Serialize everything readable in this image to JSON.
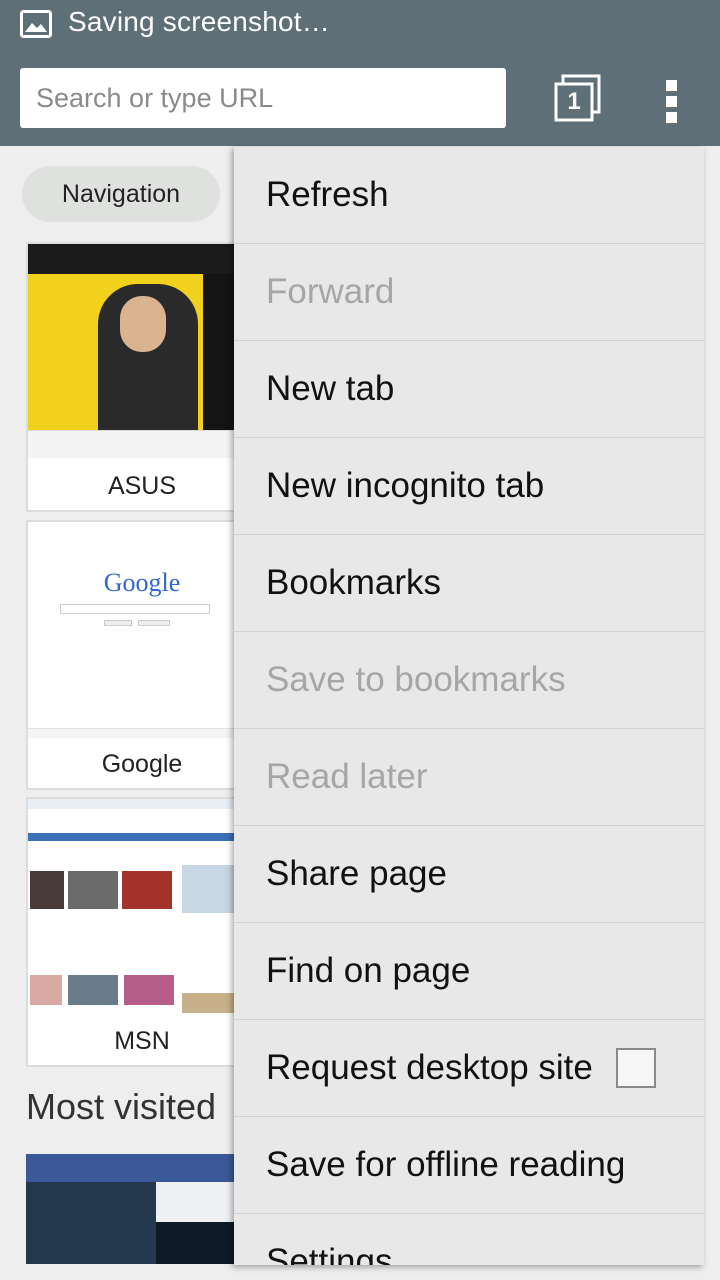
{
  "status_bar": {
    "text": "Saving screenshot…",
    "icon": "image-icon"
  },
  "toolbar": {
    "search_placeholder": "Search or type URL",
    "tab_count": "1",
    "tabs_icon": "tabs-icon",
    "menu_icon": "overflow-menu-icon"
  },
  "page": {
    "nav_chip": "Navigation",
    "tiles": [
      {
        "label": "ASUS"
      },
      {
        "label": "Google",
        "logo_text": "Google"
      },
      {
        "label": "MSN"
      }
    ],
    "most_visited": "Most visited"
  },
  "menu": {
    "items": [
      {
        "label": "Refresh",
        "enabled": true
      },
      {
        "label": "Forward",
        "enabled": false
      },
      {
        "label": "New tab",
        "enabled": true
      },
      {
        "label": "New incognito tab",
        "enabled": true
      },
      {
        "label": "Bookmarks",
        "enabled": true
      },
      {
        "label": "Save to bookmarks",
        "enabled": false
      },
      {
        "label": "Read later",
        "enabled": false
      },
      {
        "label": "Share page",
        "enabled": true
      },
      {
        "label": "Find on page",
        "enabled": true
      },
      {
        "label": "Request desktop site",
        "enabled": true,
        "checked": false
      },
      {
        "label": "Save for offline reading",
        "enabled": true
      },
      {
        "label": "Settings",
        "enabled": true
      }
    ]
  },
  "colors": {
    "toolbar": "#5f6f78",
    "menu_bg": "#e8e8e8",
    "disabled_text": "#a6a6a6"
  }
}
